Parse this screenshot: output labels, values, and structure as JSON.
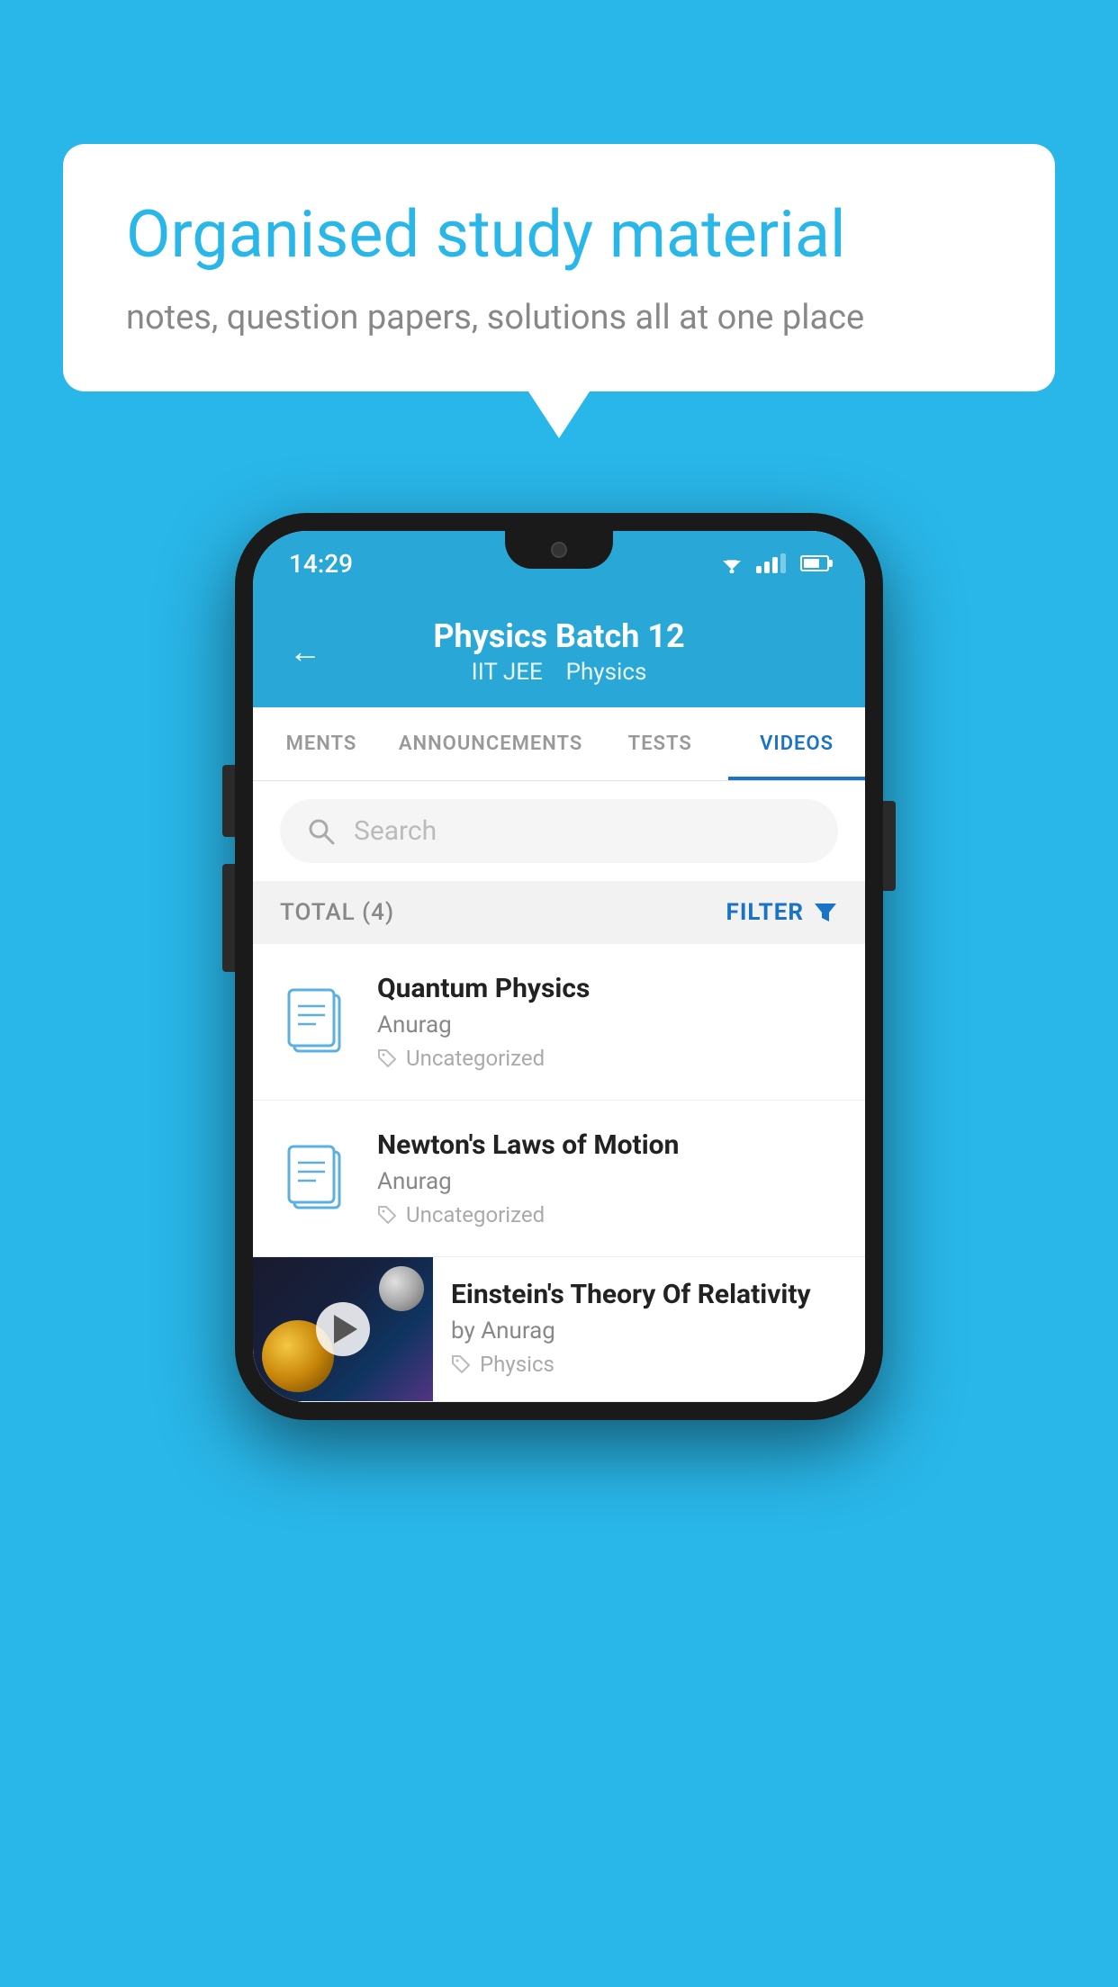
{
  "background_color": "#29b6e8",
  "speech_bubble": {
    "heading": "Organised study material",
    "subtext": "notes, question papers, solutions all at one place"
  },
  "phone": {
    "status_bar": {
      "time": "14:29"
    },
    "app_header": {
      "title": "Physics Batch 12",
      "subtitle_part1": "IIT JEE",
      "subtitle_part2": "Physics",
      "back_label": "←"
    },
    "tabs": [
      {
        "label": "MENTS",
        "active": false
      },
      {
        "label": "ANNOUNCEMENTS",
        "active": false
      },
      {
        "label": "TESTS",
        "active": false
      },
      {
        "label": "VIDEOS",
        "active": true
      }
    ],
    "search": {
      "placeholder": "Search"
    },
    "filter_bar": {
      "total_label": "TOTAL (4)",
      "filter_label": "FILTER"
    },
    "videos": [
      {
        "id": 1,
        "title": "Quantum Physics",
        "author": "Anurag",
        "tag": "Uncategorized",
        "has_thumbnail": false
      },
      {
        "id": 2,
        "title": "Newton's Laws of Motion",
        "author": "Anurag",
        "tag": "Uncategorized",
        "has_thumbnail": false
      },
      {
        "id": 3,
        "title": "Einstein's Theory Of Relativity",
        "author": "by Anurag",
        "tag": "Physics",
        "has_thumbnail": true
      }
    ]
  }
}
